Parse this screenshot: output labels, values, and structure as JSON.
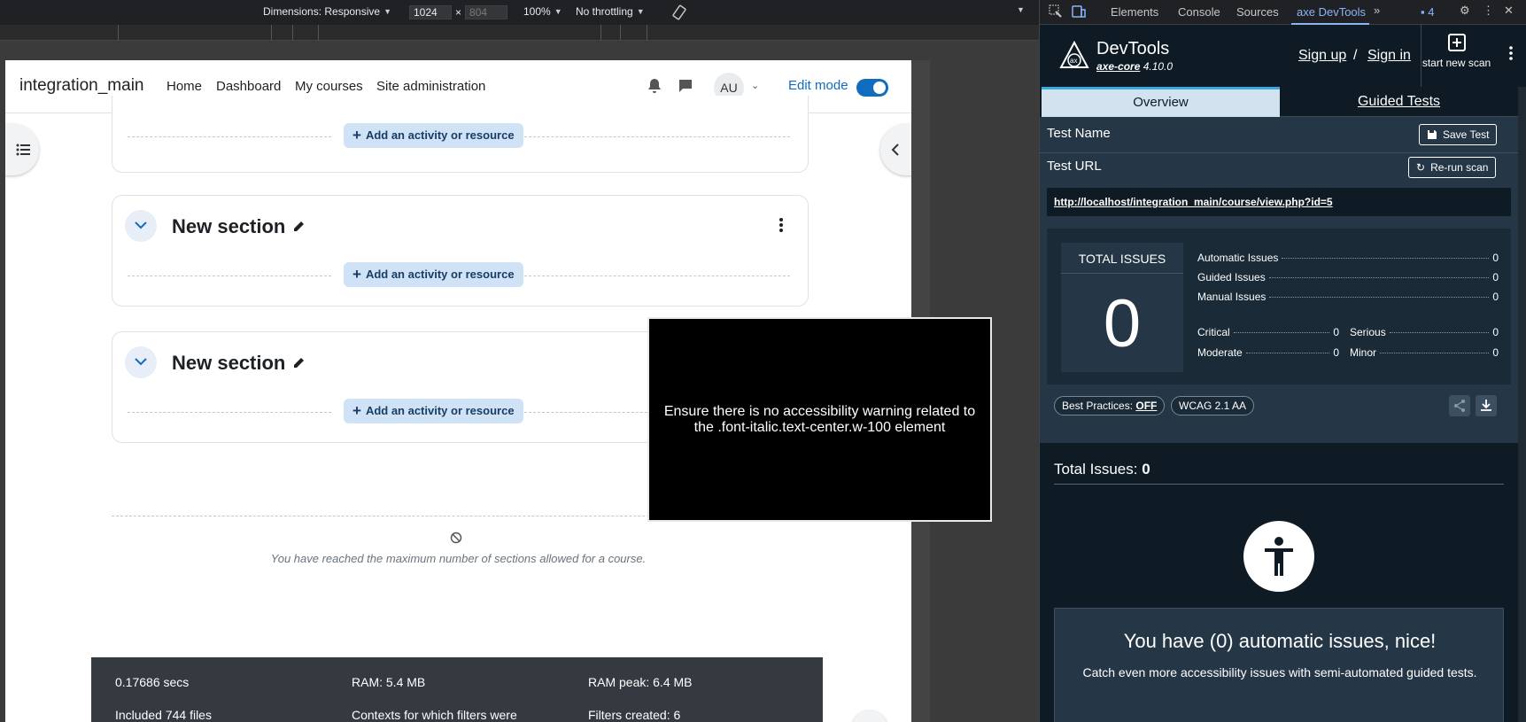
{
  "device_toolbar": {
    "dimensions_label": "Dimensions: Responsive",
    "width_value": "1024",
    "times": "×",
    "height_placeholder": "804",
    "zoom": "100%",
    "throttling": "No throttling"
  },
  "moodle": {
    "site_name": "integration_main",
    "nav": [
      "Home",
      "Dashboard",
      "My courses",
      "Site administration"
    ],
    "avatar_initials": "AU",
    "edit_mode_label": "Edit mode",
    "edit_mode_on": true,
    "add_activity_label": "Add an activity or resource",
    "sections": [
      {
        "title": "New section"
      },
      {
        "title": "New section"
      }
    ],
    "max_sections_text": "You have reached the maximum number of sections allowed for a course.",
    "footer": {
      "secs": "0.17686 secs",
      "ram": "RAM: 5.4 MB",
      "ram_peak": "RAM peak: 6.4 MB",
      "files": "Included 744 files",
      "contexts": "Contexts for which filters were",
      "filters": "Filters created: 6"
    }
  },
  "overlay_text": "Ensure there is no accessibility warning related to the .font-italic.text-center.w-100 element",
  "devtools": {
    "tabs": [
      "Elements",
      "Console",
      "Sources",
      "axe DevTools"
    ],
    "active_tab": "axe DevTools",
    "badge_count": "4",
    "axe": {
      "title": "DevTools",
      "engine": "axe-core",
      "version": "4.10.0",
      "sign_up": "Sign up",
      "slash": "/",
      "sign_in": "Sign in",
      "new_scan_label": "start new scan",
      "tab_overview": "Overview",
      "tab_guided": "Guided Tests",
      "test_name_label": "Test Name",
      "save_test": "Save Test",
      "test_url_label": "Test URL",
      "rerun_scan": "Re-run scan",
      "url": "http://localhost/integration_main/course/view.php?id=5",
      "total_issues_label": "TOTAL ISSUES",
      "total_issues": "0",
      "breakdown": [
        {
          "label": "Automatic Issues",
          "value": "0"
        },
        {
          "label": "Guided Issues",
          "value": "0"
        },
        {
          "label": "Manual Issues",
          "value": "0"
        }
      ],
      "severity": {
        "critical_label": "Critical",
        "critical": "0",
        "serious_label": "Serious",
        "serious": "0",
        "moderate_label": "Moderate",
        "moderate": "0",
        "minor_label": "Minor",
        "minor": "0"
      },
      "best_practices_label": "Best Practices:",
      "best_practices_value": "OFF",
      "standard": "WCAG 2.1 AA",
      "issues_heading": "Total Issues:",
      "issues_count": "0",
      "nice_title": "You have (0) automatic issues, nice!",
      "nice_sub": "Catch even more accessibility issues with semi-automated guided tests."
    }
  },
  "colors": {
    "moodle_primary": "#0f6cbf",
    "add_button_bg": "#cfe2f6",
    "axe_dark": "#0e1b24",
    "axe_panel": "#253746",
    "axe_accent": "#3aa9e0"
  }
}
